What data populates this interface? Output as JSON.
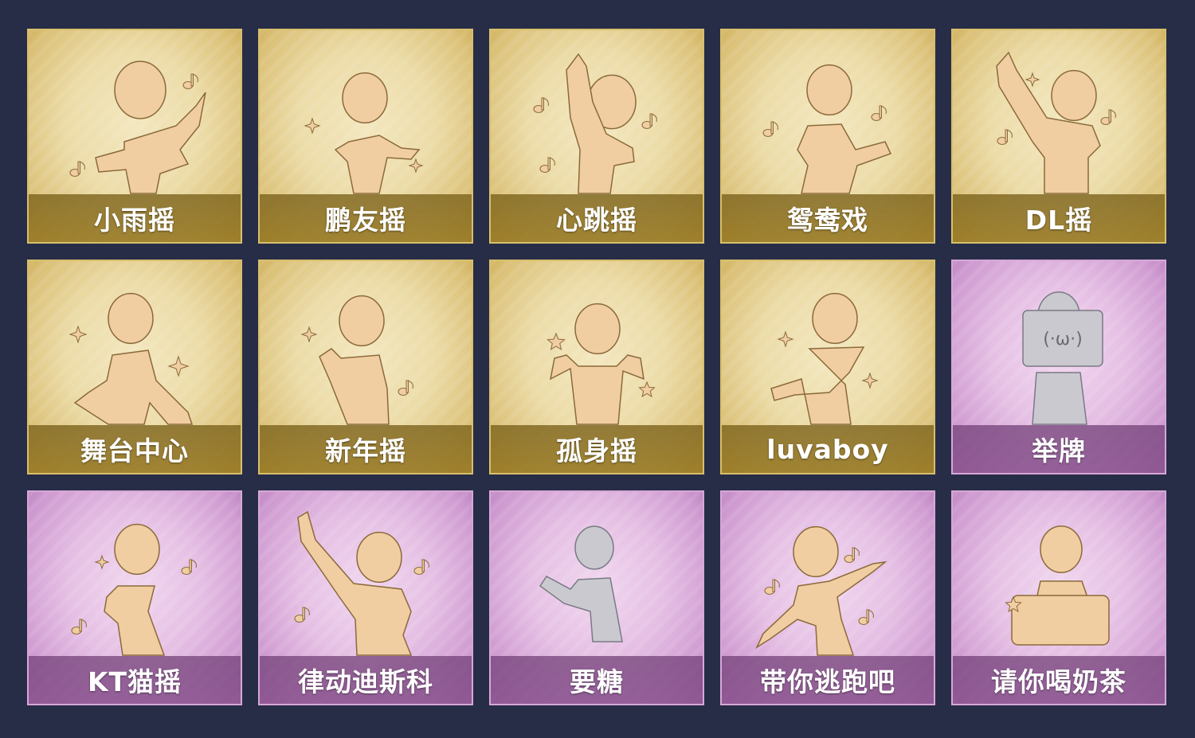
{
  "colors": {
    "background": "#272d47",
    "gold_card": "#ecdca8",
    "purple_card": "#e5bfe4",
    "figure": "#f1cda2",
    "locked_figure": "#c9c9cf"
  },
  "emotes": [
    {
      "label": "小雨摇",
      "theme": "gold",
      "icon": "figure-arms-crossed-with-notes-icon",
      "locked": false
    },
    {
      "label": "鹏友摇",
      "theme": "gold",
      "icon": "figure-pointing-sideways-icon",
      "locked": false
    },
    {
      "label": "心跳摇",
      "theme": "gold",
      "icon": "figure-hand-raised-icon",
      "locked": false
    },
    {
      "label": "鸳鸯戏",
      "theme": "gold",
      "icon": "figure-shrugging-with-notes-icon",
      "locked": false
    },
    {
      "label": "DL摇",
      "theme": "gold",
      "icon": "figure-arm-up-sparkles-icon",
      "locked": false
    },
    {
      "label": "舞台中心",
      "theme": "gold",
      "icon": "figure-hand-on-chest-sparkles-icon",
      "locked": false
    },
    {
      "label": "新年摇",
      "theme": "gold",
      "icon": "figure-clapping-icon",
      "locked": false
    },
    {
      "label": "孤身摇",
      "theme": "gold",
      "icon": "figure-fists-with-stars-icon",
      "locked": false
    },
    {
      "label": "luvaboy",
      "theme": "gold",
      "icon": "figure-crossed-arms-zigzag-icon",
      "locked": false
    },
    {
      "label": "举牌",
      "theme": "purple",
      "icon": "figure-holding-sign-icon",
      "locked": true
    },
    {
      "label": "KT猫摇",
      "theme": "purple",
      "icon": "figure-cat-pose-notes-icon",
      "locked": false
    },
    {
      "label": "律动迪斯科",
      "theme": "purple",
      "icon": "figure-disco-point-icon",
      "locked": false
    },
    {
      "label": "要糖",
      "theme": "purple",
      "icon": "figure-reaching-out-icon",
      "locked": true
    },
    {
      "label": "带你逃跑吧",
      "theme": "purple",
      "icon": "figure-pointing-forward-icon",
      "locked": false
    },
    {
      "label": "请你喝奶茶",
      "theme": "purple",
      "icon": "figure-holding-board-icon",
      "locked": false
    }
  ]
}
